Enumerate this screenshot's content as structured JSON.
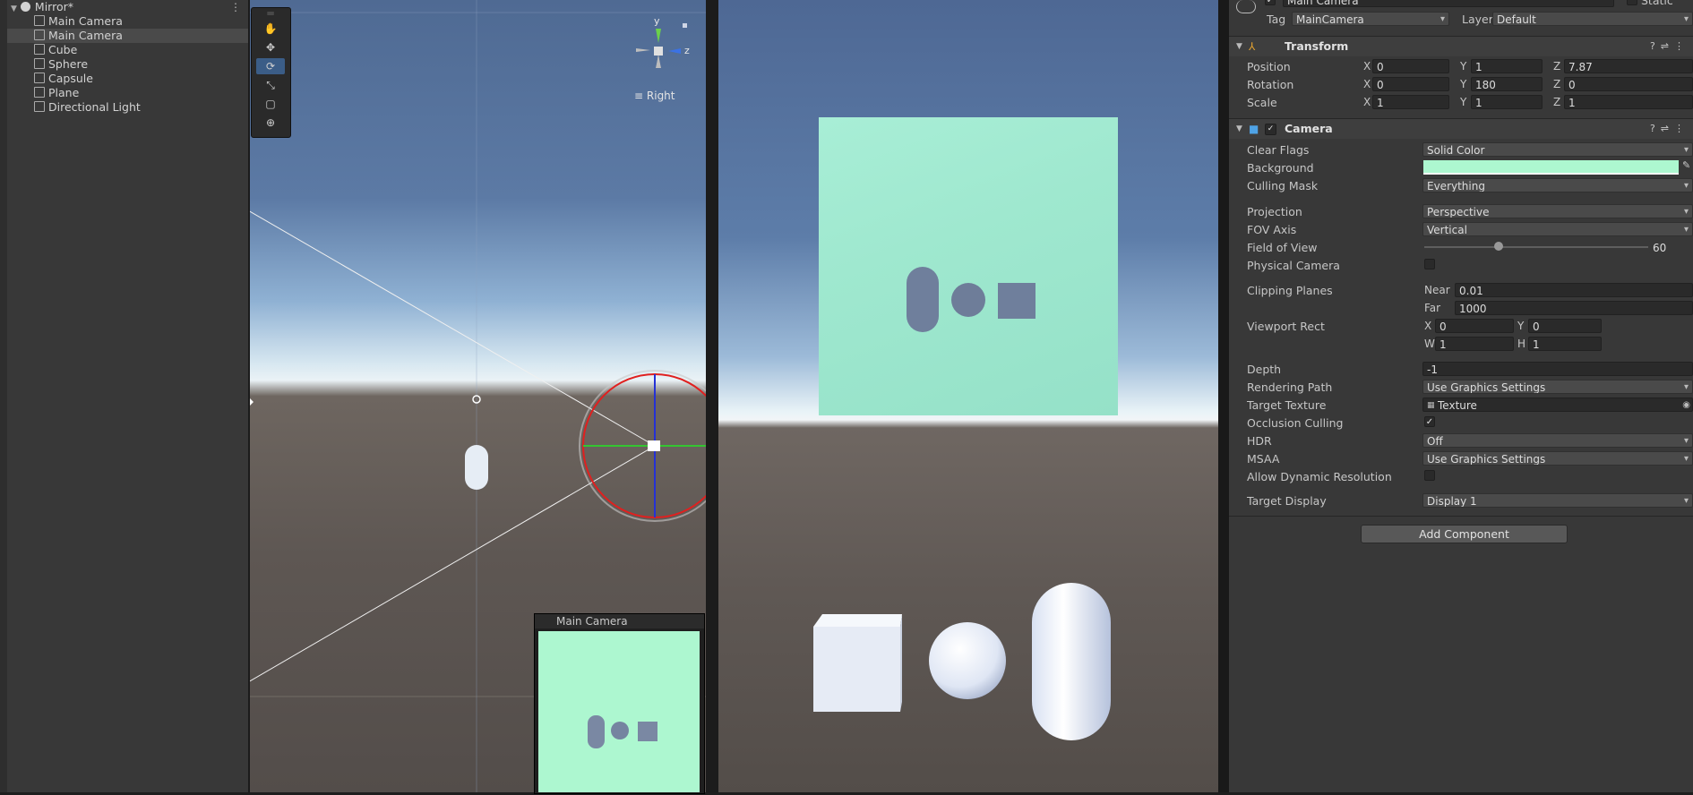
{
  "hierarchy": {
    "scene_name": "Mirror*",
    "items": [
      {
        "label": "Main Camera",
        "selected": false
      },
      {
        "label": "Main Camera",
        "selected": true
      },
      {
        "label": "Cube",
        "selected": false
      },
      {
        "label": "Sphere",
        "selected": false
      },
      {
        "label": "Capsule",
        "selected": false
      },
      {
        "label": "Plane",
        "selected": false
      },
      {
        "label": "Directional Light",
        "selected": false
      }
    ]
  },
  "scene_view": {
    "tools": [
      "hand-tool",
      "move-tool",
      "rotate-tool",
      "scale-tool",
      "rect-tool",
      "transform-tool"
    ],
    "active_tool": "rotate-tool",
    "gizmo": {
      "y_label": "y",
      "z_label": "z",
      "view_label": "Right"
    },
    "camera_preview": {
      "title": "Main Camera",
      "background": "#adf7d0"
    }
  },
  "game_view": {
    "quad_color": "#9fe8cf"
  },
  "inspector": {
    "header": {
      "object_name": "Main Camera",
      "static_label": "Static",
      "tag_label": "Tag",
      "tag_value": "MainCamera",
      "layer_label": "Layer",
      "layer_value": "Default"
    },
    "transform": {
      "title": "Transform",
      "position": {
        "label": "Position",
        "x": "0",
        "y": "1",
        "z": "7.87"
      },
      "rotation": {
        "label": "Rotation",
        "x": "0",
        "y": "180",
        "z": "0"
      },
      "scale": {
        "label": "Scale",
        "x": "1",
        "y": "1",
        "z": "1"
      }
    },
    "camera": {
      "title": "Camera",
      "enabled": true,
      "clear_flags": {
        "label": "Clear Flags",
        "value": "Solid Color"
      },
      "background": {
        "label": "Background",
        "color": "#adf7d0"
      },
      "culling_mask": {
        "label": "Culling Mask",
        "value": "Everything"
      },
      "projection": {
        "label": "Projection",
        "value": "Perspective"
      },
      "fov_axis": {
        "label": "FOV Axis",
        "value": "Vertical"
      },
      "field_of_view": {
        "label": "Field of View",
        "value": "60"
      },
      "physical_camera": {
        "label": "Physical Camera",
        "checked": false
      },
      "clipping_planes": {
        "label": "Clipping Planes",
        "near_label": "Near",
        "near": "0.01",
        "far_label": "Far",
        "far": "1000"
      },
      "viewport_rect": {
        "label": "Viewport Rect",
        "x": "0",
        "y": "0",
        "w": "1",
        "h": "1"
      },
      "depth": {
        "label": "Depth",
        "value": "-1"
      },
      "rendering_path": {
        "label": "Rendering Path",
        "value": "Use Graphics Settings"
      },
      "target_texture": {
        "label": "Target Texture",
        "value": "Texture"
      },
      "occlusion_culling": {
        "label": "Occlusion Culling",
        "checked": true
      },
      "hdr": {
        "label": "HDR",
        "value": "Off"
      },
      "msaa": {
        "label": "MSAA",
        "value": "Use Graphics Settings"
      },
      "allow_dynamic_resolution": {
        "label": "Allow Dynamic Resolution",
        "checked": false
      },
      "target_display": {
        "label": "Target Display",
        "value": "Display 1"
      }
    },
    "add_component_label": "Add Component",
    "axis_labels": {
      "x": "X",
      "y": "Y",
      "z": "Z",
      "w": "W",
      "h": "H"
    }
  }
}
